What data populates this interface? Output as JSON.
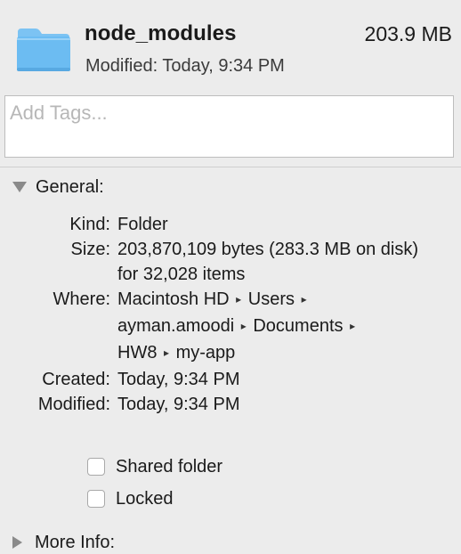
{
  "header": {
    "title": "node_modules",
    "size": "203.9 MB",
    "modified": "Modified: Today, 9:34 PM",
    "folder_icon": "folder-icon",
    "folder_color": "#5fb5ee"
  },
  "tags": {
    "placeholder": "Add Tags...",
    "value": ""
  },
  "general": {
    "label": "General:",
    "expanded": true,
    "rows": [
      {
        "key": "Kind:",
        "value": "Folder"
      },
      {
        "key": "Size:",
        "value": "203,870,109 bytes (283.3 MB on disk) for 32,028 items"
      },
      {
        "key": "Where:",
        "path": [
          "Macintosh HD",
          "Users",
          "ayman.amoodi",
          "Documents",
          "HW8",
          "my-app"
        ]
      },
      {
        "key": "Created:",
        "value": "Today, 9:34 PM"
      },
      {
        "key": "Modified:",
        "value": "Today, 9:34 PM"
      }
    ],
    "path_separator": "▸",
    "checkboxes": [
      {
        "label": "Shared folder",
        "checked": false
      },
      {
        "label": "Locked",
        "checked": false
      }
    ]
  },
  "more_info": {
    "label": "More Info:",
    "expanded": false
  }
}
